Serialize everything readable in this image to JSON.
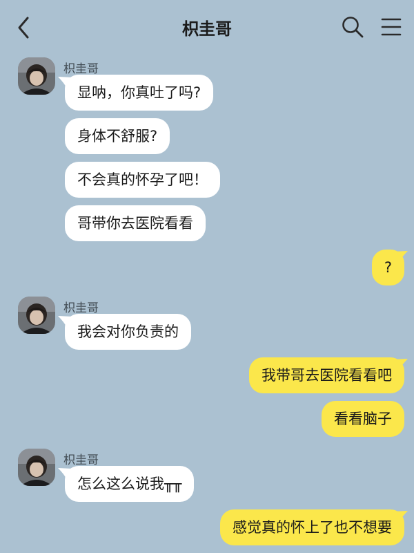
{
  "header": {
    "title": "枳圭哥",
    "back_icon": "chevron-left-icon",
    "search_icon": "search-icon",
    "menu_icon": "hamburger-menu-icon"
  },
  "colors": {
    "background": "#abc1d1",
    "incoming_bubble": "#ffffff",
    "outgoing_bubble": "#fbe74b"
  },
  "messages": [
    {
      "sender": "枳圭哥",
      "text": "显呐，你真吐了吗?"
    },
    {
      "text": "身体不舒服?"
    },
    {
      "text": "不会真的怀孕了吧！"
    },
    {
      "text": "哥带你去医院看看"
    },
    {
      "text": "?"
    },
    {
      "sender": "枳圭哥",
      "text": "我会对你负责的"
    },
    {
      "text": "我带哥去医院看看吧"
    },
    {
      "text": "看看脑子"
    },
    {
      "sender": "枳圭哥",
      "text": "怎么这么说我╥╥"
    },
    {
      "text": "感觉真的怀上了也不想要"
    }
  ]
}
